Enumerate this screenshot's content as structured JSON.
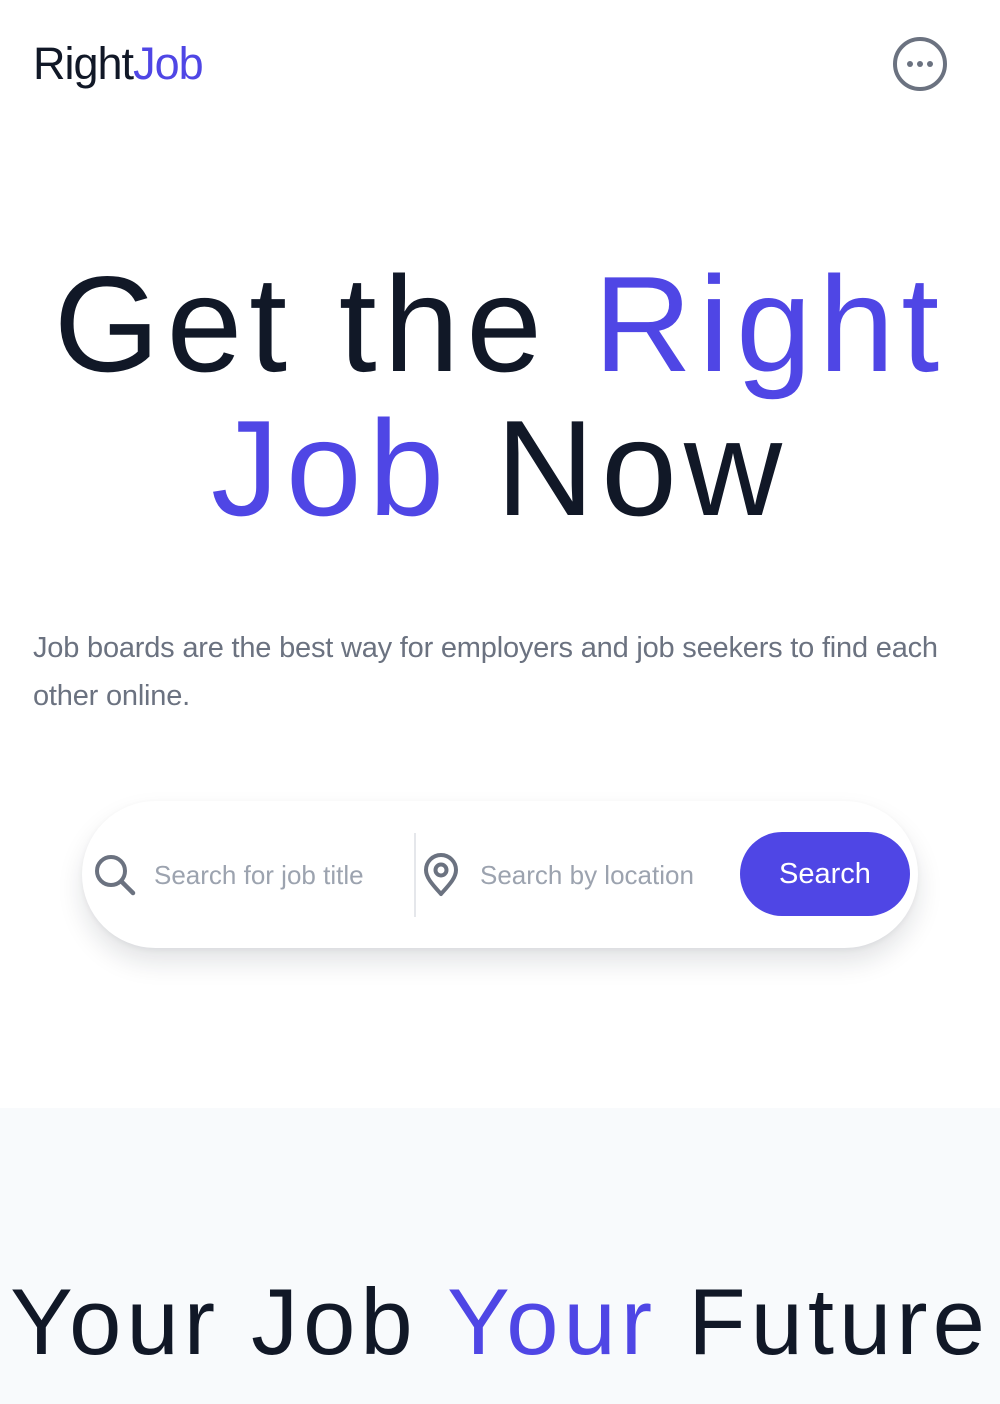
{
  "header": {
    "logo_part1": "Right",
    "logo_part2": "Job",
    "menu_icon": "more-horizontal-icon"
  },
  "hero": {
    "title_part1": "Get the ",
    "title_accent": "Right Job",
    "title_part2": " Now",
    "subtitle": "Job boards are the best way for employers and job seekers to find each other online."
  },
  "search": {
    "title_icon": "search-icon",
    "title_placeholder": "Search for job title",
    "location_icon": "map-pin-icon",
    "location_placeholder": "Search by location",
    "button_label": "Search"
  },
  "section2": {
    "title_part1": "Your Job ",
    "title_accent": "Your",
    "title_part2": " Future"
  },
  "colors": {
    "accent": "#4F46E5",
    "text_dark": "#111827",
    "text_muted": "#6B7280",
    "section_bg": "#F8FAFC"
  }
}
